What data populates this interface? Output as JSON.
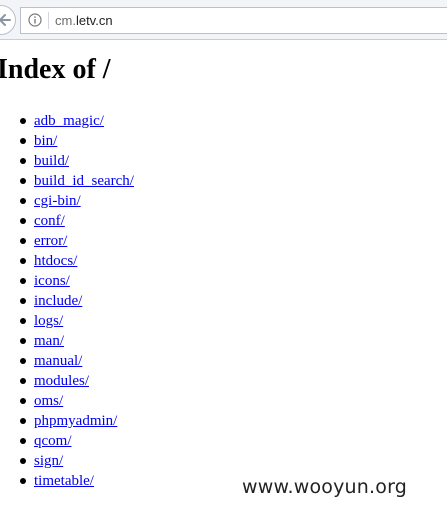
{
  "browser": {
    "address_bar": {
      "url_host_prefix": "cm.",
      "url_host_rest": "letv.cn"
    },
    "icons": {
      "back": "back-arrow-icon",
      "site_info": "info-icon"
    }
  },
  "page": {
    "title": "Index of /",
    "entries": [
      "adb_magic/",
      "bin/",
      "build/",
      "build_id_search/",
      "cgi-bin/",
      "conf/",
      "error/",
      "htdocs/",
      "icons/",
      "include/",
      "logs/",
      "man/",
      "manual/",
      "modules/",
      "oms/",
      "phpmyadmin/",
      "qcom/",
      "sign/",
      "timetable/"
    ],
    "link_color": "#0000ee"
  },
  "watermark": {
    "text": "www.wooyun.org"
  }
}
